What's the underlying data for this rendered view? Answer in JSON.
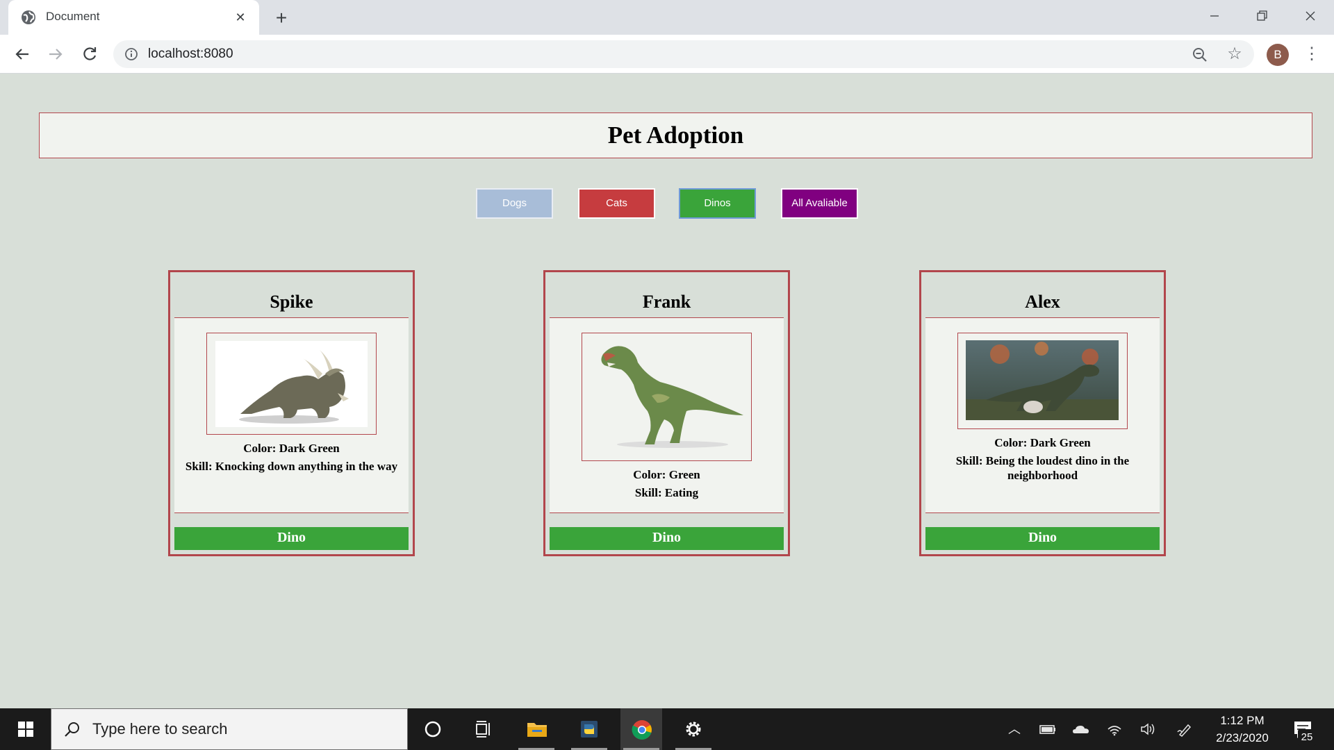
{
  "browser": {
    "tab_title": "Document",
    "url": "localhost:8080",
    "avatar_letter": "B"
  },
  "page": {
    "title": "Pet Adoption",
    "filters": [
      {
        "label": "Dogs",
        "color": "#a8bdd8"
      },
      {
        "label": "Cats",
        "color": "#c63c3f"
      },
      {
        "label": "Dinos",
        "color": "#3aa43a"
      },
      {
        "label": "All Avaliable",
        "color": "#800080"
      }
    ],
    "pets": [
      {
        "name": "Spike",
        "color": "Color: Dark Green",
        "skill": "Skill: Knocking down anything in the way",
        "type": "Dino",
        "image": "triceratops"
      },
      {
        "name": "Frank",
        "color": "Color: Green",
        "skill": "Skill: Eating",
        "type": "Dino",
        "image": "theropod"
      },
      {
        "name": "Alex",
        "color": "Color: Dark Green",
        "skill": "Skill: Being the loudest dino in the neighborhood",
        "type": "Dino",
        "image": "t-rex-scene"
      }
    ],
    "accent_colors": {
      "border": "#b2464c",
      "dino_green": "#3aa43a",
      "background": "#d8dfd8"
    }
  },
  "taskbar": {
    "search_placeholder": "Type here to search",
    "time": "1:12 PM",
    "date": "2/23/2020",
    "notification_count": "25",
    "pinned": [
      "cortana-icon",
      "task-view-icon",
      "file-explorer-icon",
      "python-icon",
      "chrome-icon",
      "settings-icon"
    ]
  }
}
